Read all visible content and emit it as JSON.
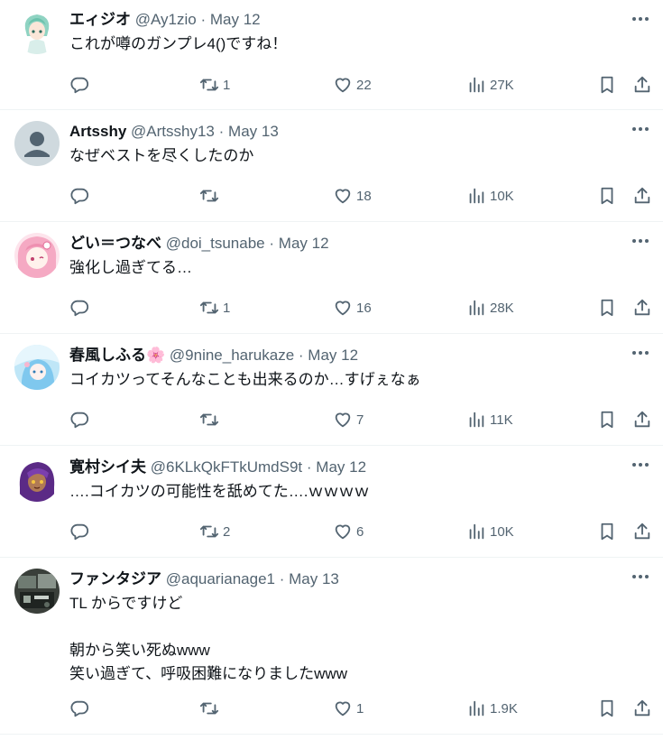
{
  "tweets": [
    {
      "name": "エィジオ",
      "handle": "@Ay1zio",
      "date": "May 12",
      "text": "これが噂のガンプレ4()ですね！",
      "retweets": "1",
      "likes": "22",
      "views": "27K",
      "avatar": "anime-green-hair"
    },
    {
      "name": "Artsshy",
      "handle": "@Artsshy13",
      "date": "May 13",
      "text": "なぜベストを尽くしたのか",
      "retweets": "",
      "likes": "18",
      "views": "10K",
      "avatar": "default-profile"
    },
    {
      "name": "どい＝つなべ",
      "handle": "@doi_tsunabe",
      "date": "May 12",
      "text": "強化し過ぎてる…",
      "retweets": "1",
      "likes": "16",
      "views": "28K",
      "avatar": "anime-pink-hair"
    },
    {
      "name": "春風しふる🌸",
      "handle": "@9nine_harukaze",
      "date": "May 12",
      "text": "コイカツってそんなことも出来るのか…すげぇなぁ",
      "retweets": "",
      "likes": "7",
      "views": "11K",
      "avatar": "anime-blue-sky"
    },
    {
      "name": "寛村シイ夫",
      "handle": "@6KLkQkFTkUmdS9t",
      "date": "May 12",
      "text": "….コイカツの可能性を舐めてた….ｗｗｗｗ",
      "retweets": "2",
      "likes": "6",
      "views": "10K",
      "avatar": "anime-purple-hair"
    },
    {
      "name": "ファンタジア",
      "handle": "@aquarianage1",
      "date": "May 13",
      "text": "TL からですけど\n\n朝から笑い死ぬwww\n笑い過ぎて、呼吸困難になりましたwww",
      "retweets": "",
      "likes": "1",
      "views": "1.9K",
      "avatar": "photo-machine-room"
    }
  ],
  "icons": {
    "reply": "reply-icon",
    "retweet": "retweet-icon",
    "like": "heart-icon",
    "views": "views-icon",
    "bookmark": "bookmark-icon",
    "share": "share-icon",
    "more": "more-icon"
  },
  "colors": {
    "text": "#0f1419",
    "secondary": "#536471",
    "divider": "#eff3f4"
  },
  "separator": "·"
}
